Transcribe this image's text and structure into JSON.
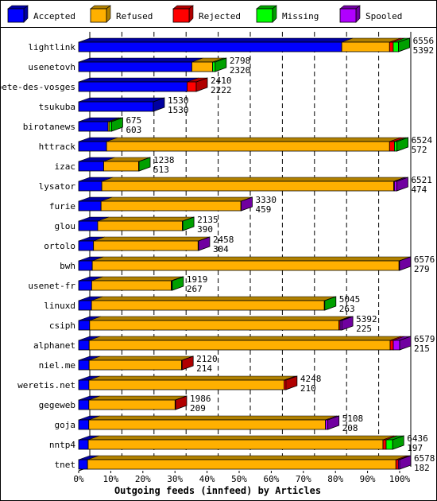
{
  "chart_data": {
    "type": "bar",
    "orientation": "horizontal",
    "stacked": true,
    "style": "3d",
    "xlabel": "Outgoing feeds (innfeed) by Articles",
    "xlim": [
      0,
      100
    ],
    "xticks": [
      "0%",
      "10%",
      "20%",
      "30%",
      "40%",
      "50%",
      "60%",
      "70%",
      "80%",
      "90%",
      "100%"
    ],
    "grid": "vertical-dashed",
    "legend_placement": "top",
    "series": [
      {
        "name": "Accepted",
        "color": "#0000ff",
        "side": "#0000a0"
      },
      {
        "name": "Refused",
        "color": "#ffb000",
        "side": "#b08000"
      },
      {
        "name": "Rejected",
        "color": "#ff0000",
        "side": "#b00000"
      },
      {
        "name": "Missing",
        "color": "#00ff00",
        "side": "#00a000"
      },
      {
        "name": "Spooled",
        "color": "#b000ff",
        "side": "#7000a0"
      }
    ],
    "rows": [
      {
        "label": "lightlink",
        "total": "6556",
        "accepted_label": "5392",
        "values": [
          5392,
          980,
          75,
          109,
          0
        ]
      },
      {
        "label": "usenetovh",
        "total": "2798",
        "accepted_label": "2320",
        "values": [
          2320,
          424,
          0,
          54,
          0
        ]
      },
      {
        "label": "bete-des-vosges",
        "total": "2410",
        "accepted_label": "2222",
        "values": [
          2222,
          0,
          188,
          0,
          0
        ]
      },
      {
        "label": "tsukuba",
        "total": "1530",
        "accepted_label": "1530",
        "values": [
          1530,
          0,
          0,
          0,
          0
        ]
      },
      {
        "label": "birotanews",
        "total": "675",
        "accepted_label": "603",
        "values": [
          603,
          30,
          0,
          42,
          0
        ]
      },
      {
        "label": "httrack",
        "total": "6524",
        "accepted_label": "572",
        "values": [
          572,
          5800,
          100,
          52,
          0
        ]
      },
      {
        "label": "izac",
        "total": "1238",
        "accepted_label": "513",
        "values": [
          513,
          715,
          0,
          10,
          0
        ]
      },
      {
        "label": "lysator",
        "total": "6521",
        "accepted_label": "474",
        "values": [
          474,
          5982,
          15,
          0,
          50
        ]
      },
      {
        "label": "furie",
        "total": "3330",
        "accepted_label": "459",
        "values": [
          459,
          2866,
          0,
          0,
          5
        ]
      },
      {
        "label": "glou",
        "total": "2135",
        "accepted_label": "390",
        "values": [
          390,
          1735,
          0,
          10,
          0
        ]
      },
      {
        "label": "ortolo",
        "total": "2458",
        "accepted_label": "304",
        "values": [
          304,
          2144,
          0,
          0,
          10
        ]
      },
      {
        "label": "bwh",
        "total": "6576",
        "accepted_label": "279",
        "values": [
          279,
          6287,
          0,
          0,
          10
        ]
      },
      {
        "label": "usenet-fr",
        "total": "1919",
        "accepted_label": "267",
        "values": [
          267,
          1630,
          12,
          10,
          0
        ]
      },
      {
        "label": "linuxd",
        "total": "5045",
        "accepted_label": "263",
        "values": [
          263,
          4772,
          0,
          10,
          0
        ]
      },
      {
        "label": "csiph",
        "total": "5392",
        "accepted_label": "225",
        "values": [
          225,
          5110,
          25,
          0,
          32
        ]
      },
      {
        "label": "alphanet",
        "total": "6579",
        "accepted_label": "215",
        "values": [
          215,
          6169,
          65,
          0,
          130
        ]
      },
      {
        "label": "niel.me",
        "total": "2120",
        "accepted_label": "214",
        "values": [
          214,
          1896,
          10,
          0,
          0
        ]
      },
      {
        "label": "weretis.net",
        "total": "4248",
        "accepted_label": "210",
        "values": [
          210,
          3998,
          40,
          0,
          0
        ]
      },
      {
        "label": "gegeweb",
        "total": "1986",
        "accepted_label": "209",
        "values": [
          209,
          1767,
          10,
          0,
          0
        ]
      },
      {
        "label": "goja",
        "total": "5108",
        "accepted_label": "208",
        "values": [
          208,
          4850,
          0,
          0,
          50
        ]
      },
      {
        "label": "nntp4",
        "total": "6436",
        "accepted_label": "197",
        "values": [
          197,
          6040,
          65,
          134,
          0
        ]
      },
      {
        "label": "tnet",
        "total": "6578",
        "accepted_label": "182",
        "values": [
          182,
          6320,
          50,
          0,
          26
        ]
      }
    ]
  }
}
